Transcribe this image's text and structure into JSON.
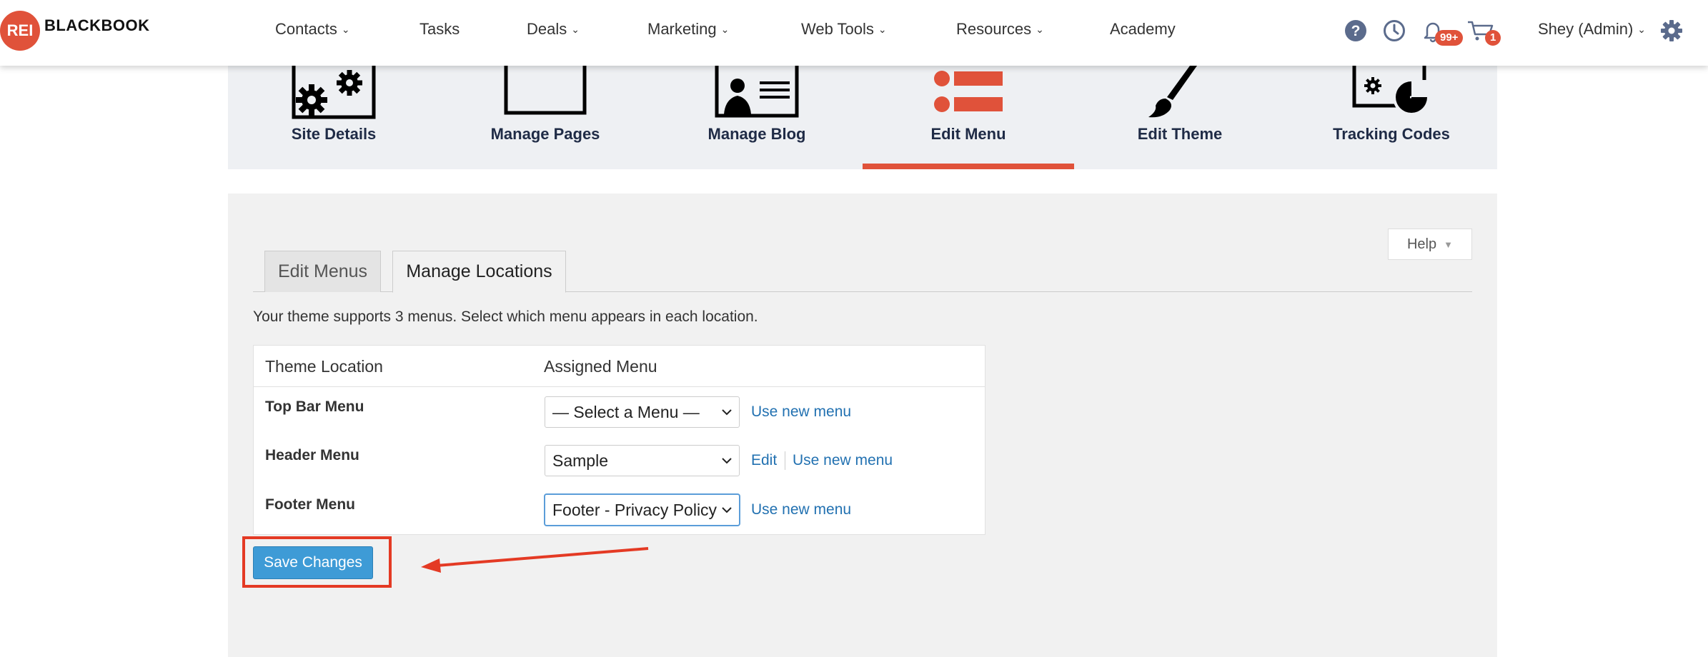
{
  "brand": {
    "logo_mark": "REI",
    "logo_name": "BLACKBOOK",
    "accent": "#e0523a",
    "link_color": "#2271b1"
  },
  "nav": {
    "items": [
      {
        "label": "Contacts",
        "has_caret": true
      },
      {
        "label": "Tasks",
        "has_caret": false
      },
      {
        "label": "Deals",
        "has_caret": true
      },
      {
        "label": "Marketing",
        "has_caret": true
      },
      {
        "label": "Web Tools",
        "has_caret": true
      },
      {
        "label": "Resources",
        "has_caret": true
      },
      {
        "label": "Academy",
        "has_caret": false
      }
    ],
    "caret": "⌄",
    "icons": [
      "help-icon",
      "clock-icon",
      "bell-icon",
      "cart-icon",
      "gear-icon"
    ],
    "notifications_badge": "99+",
    "cart_badge": "1",
    "user_label": "Shey (Admin)"
  },
  "tiles": [
    {
      "label": "Site Details",
      "icon": "site-details-icon",
      "active": false
    },
    {
      "label": "Manage  Pages",
      "icon": "pages-icon",
      "active": false
    },
    {
      "label": "Manage  Blog",
      "icon": "blog-icon",
      "active": false
    },
    {
      "label": "Edit  Menu",
      "icon": "menu-icon",
      "active": true
    },
    {
      "label": "Edit  Theme",
      "icon": "brush-icon",
      "active": false
    },
    {
      "label": "Tracking  Codes",
      "icon": "tracking-icon",
      "active": false
    }
  ],
  "panel": {
    "help_label": "Help",
    "help_arrow": "▼",
    "tabs": [
      {
        "label": "Edit Menus",
        "active": false
      },
      {
        "label": "Manage Locations",
        "active": true
      }
    ],
    "description": "Your theme supports 3 menus. Select which menu appears in each location.",
    "table": {
      "headers": [
        "Theme Location",
        "Assigned Menu"
      ],
      "rows": [
        {
          "location": "Top Bar Menu",
          "selected": "— Select a Menu —",
          "edit_link": "",
          "new_link": "Use new menu"
        },
        {
          "location": "Header Menu",
          "selected": "Sample",
          "edit_link": "Edit",
          "new_link": "Use new menu"
        },
        {
          "location": "Footer Menu",
          "selected": "Footer - Privacy Policy",
          "edit_link": "",
          "new_link": "Use new menu"
        }
      ]
    },
    "save_label": "Save Changes"
  },
  "annotation": {
    "color": "#e43a24"
  }
}
